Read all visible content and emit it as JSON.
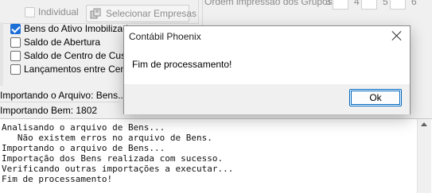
{
  "background": {
    "individual_label": "Individual",
    "select_companies_label": "Selecionar Empresas",
    "order_label": "Ordem impressão dos Grupos:",
    "order_numbers": [
      "3",
      "4",
      "5",
      "6"
    ],
    "checkbox_items": [
      {
        "label": "Bens do Ativo Imobilizado",
        "checked": true
      },
      {
        "label": "Saldo de Abertura",
        "checked": false
      },
      {
        "label": "Saldo de Centro de Custo",
        "checked": false
      },
      {
        "label": "Lançamentos entre Centros",
        "checked": false
      }
    ],
    "status_file": "Importando o Arquivo: Bens...",
    "status_item": "Importando Bem: 1802",
    "log_lines": [
      "Analisando o arquivo de Bens...",
      "   Não existem erros no arquivo de Bens.",
      "Importando o arquivo de Bens...",
      "Importação dos Bens realizada com sucesso.",
      "Verificando outras importações a executar...",
      "Fim de processamento!"
    ]
  },
  "dialog": {
    "title": "Contábil Phoenix",
    "message": "Fim de processamento!",
    "ok_label": "Ok"
  },
  "colors": {
    "accent": "#0067c0",
    "checkbox_checked": "#1d6fd8"
  }
}
